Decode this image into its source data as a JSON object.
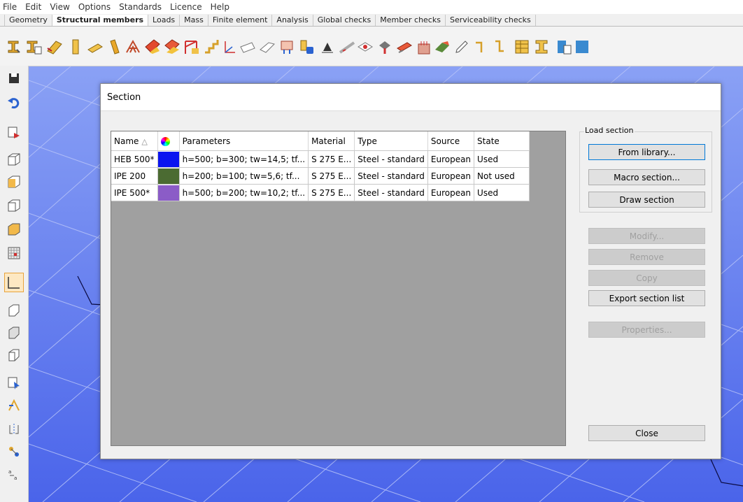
{
  "menu": [
    "File",
    "Edit",
    "View",
    "Options",
    "Standards",
    "Licence",
    "Help"
  ],
  "tabs": [
    {
      "label": "Geometry",
      "active": false
    },
    {
      "label": "Structural members",
      "active": true
    },
    {
      "label": "Loads",
      "active": false
    },
    {
      "label": "Mass",
      "active": false
    },
    {
      "label": "Finite element",
      "active": false
    },
    {
      "label": "Analysis",
      "active": false
    },
    {
      "label": "Global checks",
      "active": false
    },
    {
      "label": "Member checks",
      "active": false
    },
    {
      "label": "Serviceability checks",
      "active": false
    }
  ],
  "dialog": {
    "title": "Section",
    "columns": {
      "name": "Name",
      "parameters": "Parameters",
      "material": "Material",
      "type": "Type",
      "source": "Source",
      "state": "State"
    },
    "sort_indicator": "△",
    "rows": [
      {
        "name": "HEB 500*",
        "color": "#0a14f0",
        "parameters": "h=500; b=300; tw=14,5; tf...",
        "material": "S 275 E...",
        "type": "Steel - standard",
        "source": "European",
        "state": "Used"
      },
      {
        "name": "IPE 200",
        "color": "#4b6b32",
        "parameters": "h=200; b=100; tw=5,6; tf...",
        "material": "S 275 E...",
        "type": "Steel - standard",
        "source": "European",
        "state": "Not used"
      },
      {
        "name": "IPE 500*",
        "color": "#8b5cc7",
        "parameters": "h=500; b=200; tw=10,2; tf...",
        "material": "S 275 E...",
        "type": "Steel - standard",
        "source": "European",
        "state": "Used"
      }
    ],
    "load_section_label": "Load section",
    "buttons": {
      "from_library": "From library...",
      "macro_section": "Macro section...",
      "draw_section": "Draw section",
      "modify": "Modify...",
      "remove": "Remove",
      "copy": "Copy",
      "export": "Export section list",
      "properties": "Properties...",
      "close": "Close"
    }
  }
}
